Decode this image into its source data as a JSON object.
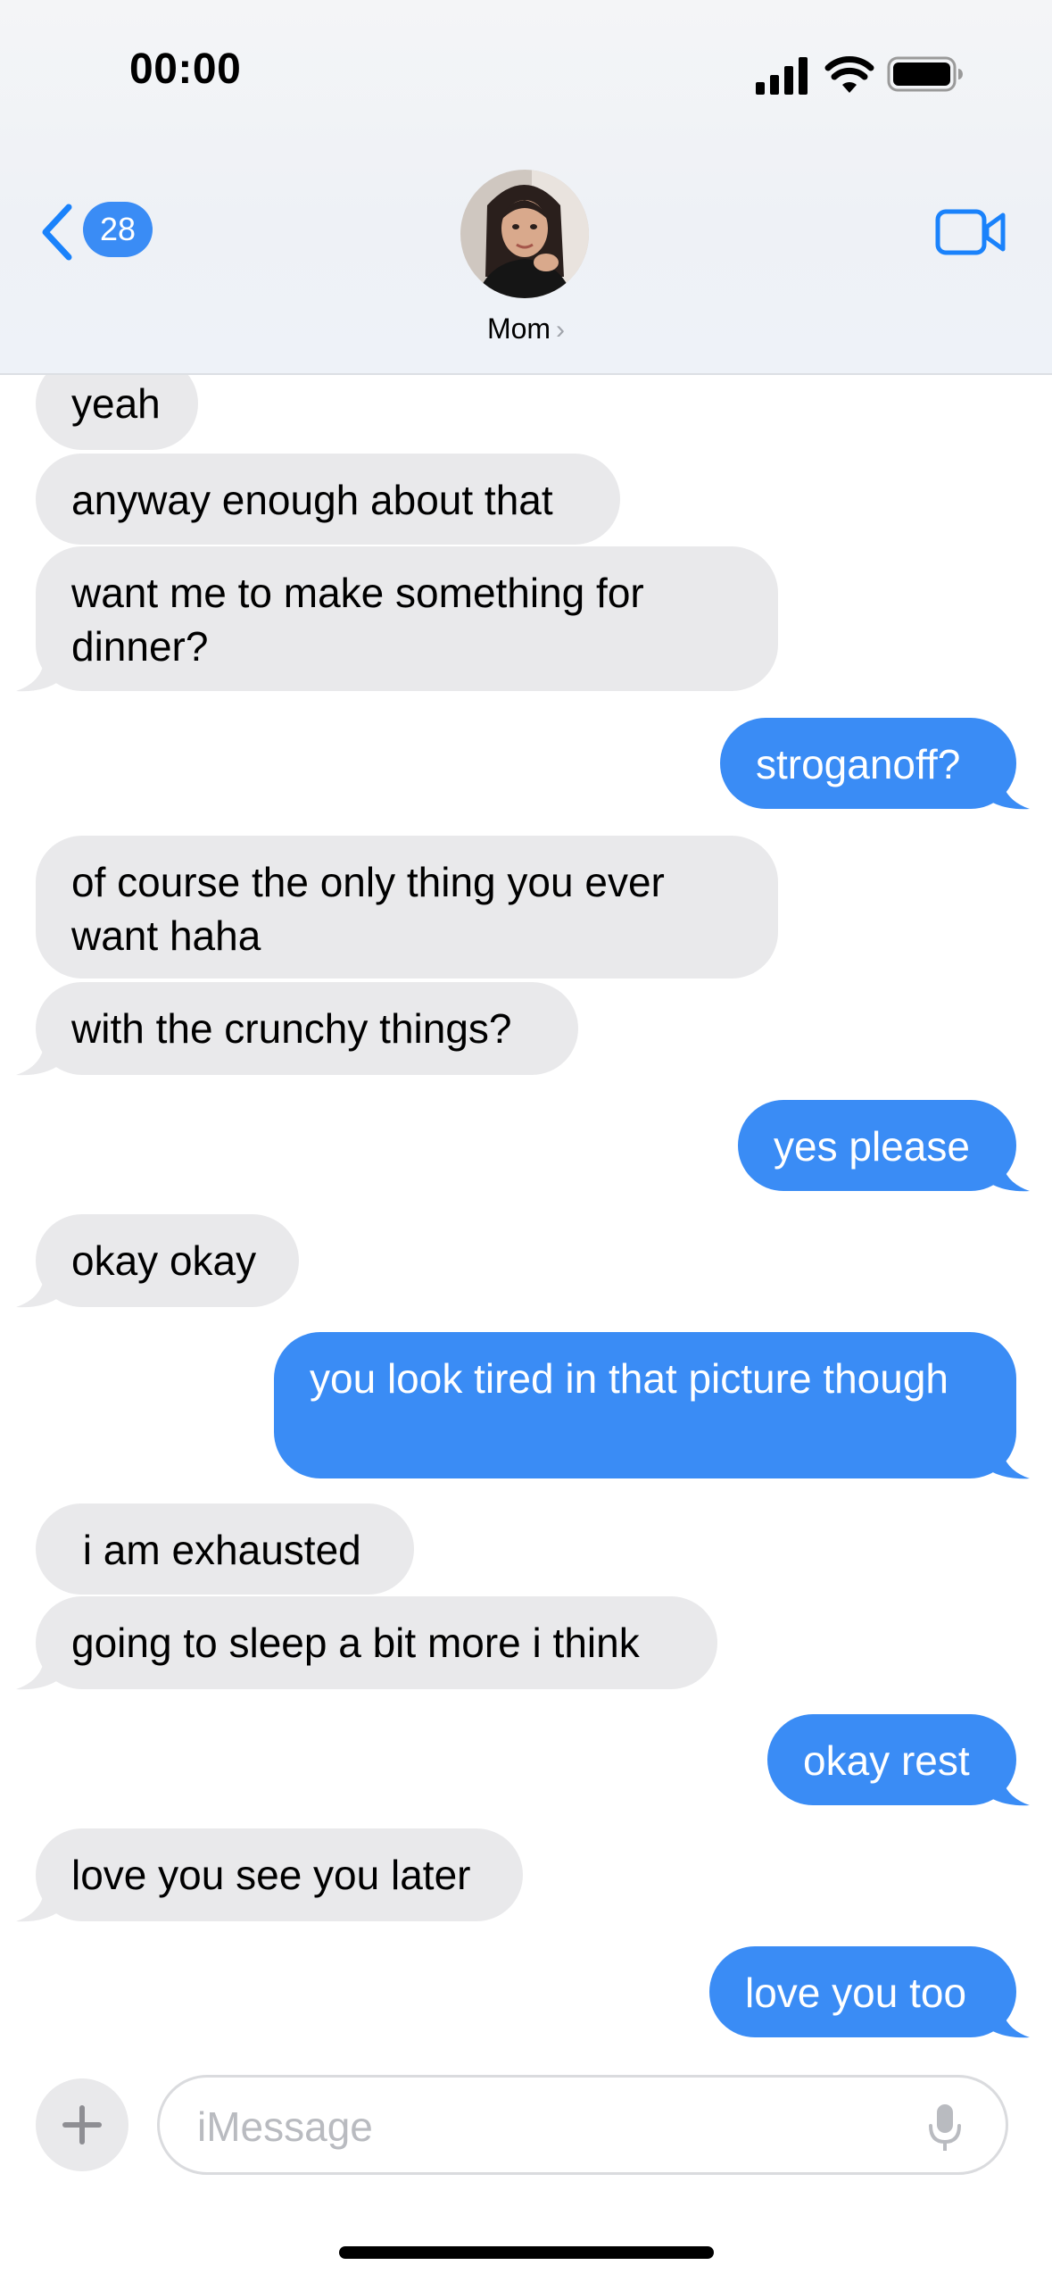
{
  "status_bar": {
    "time": "00:00"
  },
  "header": {
    "back_badge_count": "28",
    "contact_name": "Mom",
    "contact_chevron": "›",
    "icons": {
      "back": "chevron-left-icon",
      "facetime": "video-camera-icon",
      "signal": "cellular-signal-icon",
      "wifi": "wifi-icon",
      "battery": "battery-icon"
    }
  },
  "messages": [
    {
      "from": "them",
      "text": "yeah"
    },
    {
      "from": "them",
      "text": "anyway enough about that"
    },
    {
      "from": "them",
      "text": "want me to make something for dinner?"
    },
    {
      "from": "me",
      "text": "stroganoff?"
    },
    {
      "from": "them",
      "text": "of course the only thing you ever want haha"
    },
    {
      "from": "them",
      "text": "with the crunchy things?"
    },
    {
      "from": "me",
      "text": "yes please"
    },
    {
      "from": "them",
      "text": "okay okay"
    },
    {
      "from": "me",
      "text": "you look tired in that picture though"
    },
    {
      "from": "them",
      "text": " i am exhausted"
    },
    {
      "from": "them",
      "text": "going to sleep a bit more i think"
    },
    {
      "from": "me",
      "text": "okay rest"
    },
    {
      "from": "them",
      "text": "love you see you later"
    },
    {
      "from": "me",
      "text": "love you too"
    }
  ],
  "input_bar": {
    "placeholder": "iMessage",
    "icons": {
      "add": "plus-icon",
      "mic": "microphone-icon"
    }
  },
  "colors": {
    "sent_bubble": "#3a8cf5",
    "received_bubble": "#e9e9eb",
    "accent": "#1a82fb"
  }
}
